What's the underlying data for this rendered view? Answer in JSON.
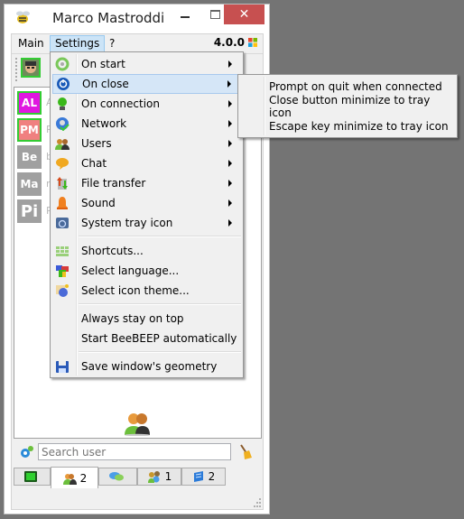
{
  "window": {
    "title": "Marco Mastroddi",
    "close_glyph": "✕"
  },
  "menubar": {
    "items": [
      "Main",
      "Settings",
      "?"
    ],
    "active": "Settings",
    "version": "4.0.0"
  },
  "users": [
    {
      "initials": "AL",
      "bg": "#e017e0",
      "border": "#33cc33",
      "name": "A"
    },
    {
      "initials": "PM",
      "bg": "#f08080",
      "border": "#33cc33",
      "name": "P"
    },
    {
      "initials": "Be",
      "bg": "#a0a0a0",
      "border": "#a0a0a0",
      "name": "b"
    },
    {
      "initials": "Ma",
      "bg": "#a0a0a0",
      "border": "#a0a0a0",
      "name": "n"
    },
    {
      "initials": "Pi",
      "bg": "#a0a0a0",
      "border": "#a0a0a0",
      "name": "P"
    }
  ],
  "search": {
    "placeholder": "Search user"
  },
  "tabs": [
    {
      "icon": "chat-screen-icon",
      "count": ""
    },
    {
      "icon": "users-icon",
      "count": "2"
    },
    {
      "icon": "chats-icon",
      "count": ""
    },
    {
      "icon": "groups-icon",
      "count": "1"
    },
    {
      "icon": "file-share-icon",
      "count": "2"
    }
  ],
  "settings_menu": {
    "submenus": [
      "On start",
      "On close",
      "On connection",
      "Network",
      "Users",
      "Chat",
      "File transfer",
      "Sound",
      "System tray icon"
    ],
    "highlighted": "On close",
    "actions": [
      "Shortcuts...",
      "Select language...",
      "Select icon theme..."
    ],
    "toggles": [
      "Always stay on top",
      "Start BeeBEEP automatically"
    ],
    "geometry": "Save window's geometry"
  },
  "on_close_submenu": [
    "Prompt on quit when connected",
    "Close button minimize to tray icon",
    "Escape key minimize to tray icon"
  ]
}
